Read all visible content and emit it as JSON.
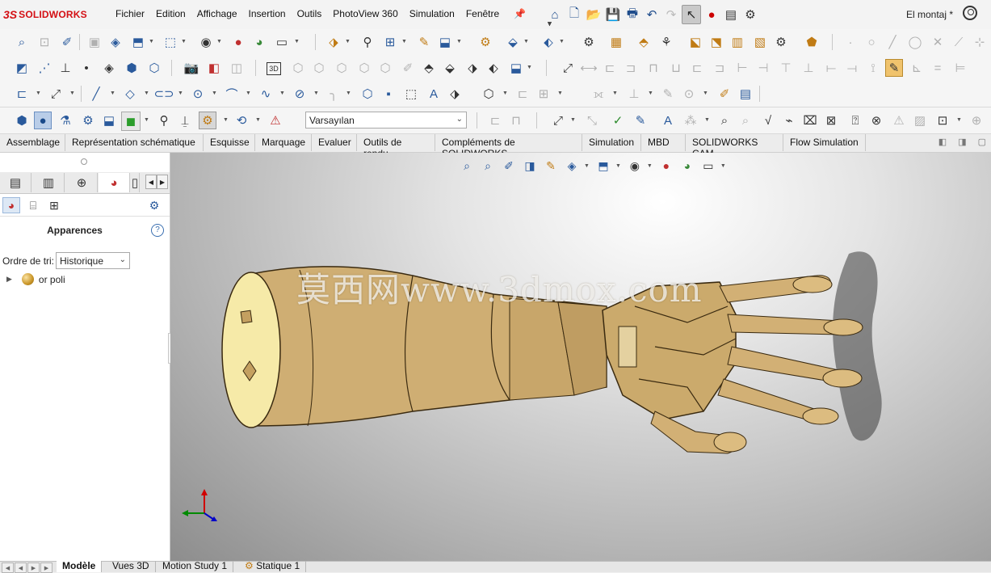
{
  "app": {
    "logo_ds": "3S",
    "logo_text": "SOLIDWORKS",
    "document_title": "El montaj *"
  },
  "menu": {
    "items": [
      "Fichier",
      "Edition",
      "Affichage",
      "Insertion",
      "Outils",
      "PhotoView 360",
      "Simulation",
      "Fenêtre"
    ]
  },
  "toolbar": {
    "display_state": "Varsayılan"
  },
  "command_tabs": [
    "Assemblage",
    "Représentation schématique",
    "Esquisse",
    "Marquage",
    "Evaluer",
    "Outils de rendu",
    "Compléments de SOLIDWORKS",
    "Simulation",
    "MBD",
    "SOLIDWORKS CAM",
    "Flow Simulation"
  ],
  "left_panel": {
    "title": "Apparences",
    "sort_label": "Ordre de tri:",
    "sort_value": "Historique",
    "tree": [
      {
        "label": "or poli",
        "icon": "gold-sphere-icon"
      }
    ]
  },
  "viewport": {
    "watermark": "莫西网www.3dmox.com",
    "model_color": "#d4b277",
    "triad_colors": {
      "x": "#d00000",
      "y": "#008a00",
      "z": "#0000c8"
    }
  },
  "bottom_tabs": [
    "Modèle",
    "Vues 3D",
    "Motion Study 1",
    "Statique 1"
  ],
  "colors": {
    "accent": "#1f4d8c",
    "brand_red": "#d40f14",
    "active_tool": "#f0c36d"
  }
}
